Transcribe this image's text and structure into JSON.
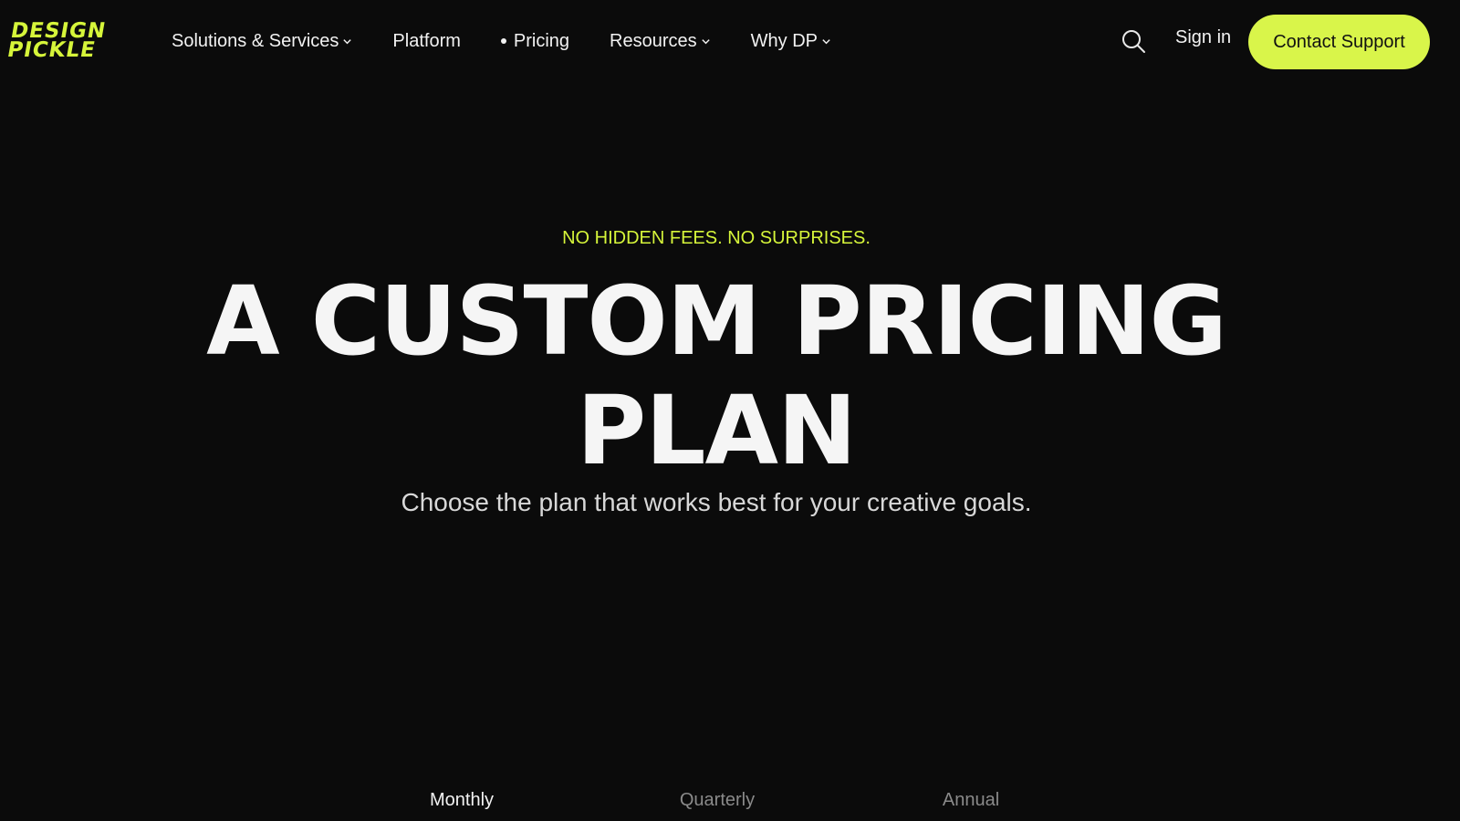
{
  "brand": {
    "logo_line1": "DESIGN",
    "logo_line2": "PICKLE",
    "accent_color": "#d9f54a"
  },
  "nav": {
    "items": [
      {
        "label": "Solutions & Services",
        "has_dropdown": true
      },
      {
        "label": "Platform",
        "has_dropdown": false
      },
      {
        "label": "Pricing",
        "has_dropdown": false,
        "active": true
      },
      {
        "label": "Resources",
        "has_dropdown": true
      },
      {
        "label": "Why DP",
        "has_dropdown": true
      }
    ],
    "search_icon": "search-icon",
    "signin_label": "Sign in",
    "cta_label": "Contact Support"
  },
  "hero": {
    "eyebrow": "NO HIDDEN FEES. NO SURPRISES.",
    "title_line1": "A CUSTOM PRICING",
    "title_line2": "PLAN",
    "subtitle": "Choose the plan that works best for your creative goals."
  },
  "billing": {
    "options": [
      "Monthly",
      "Quarterly",
      "Annual"
    ],
    "selected": "Monthly"
  }
}
